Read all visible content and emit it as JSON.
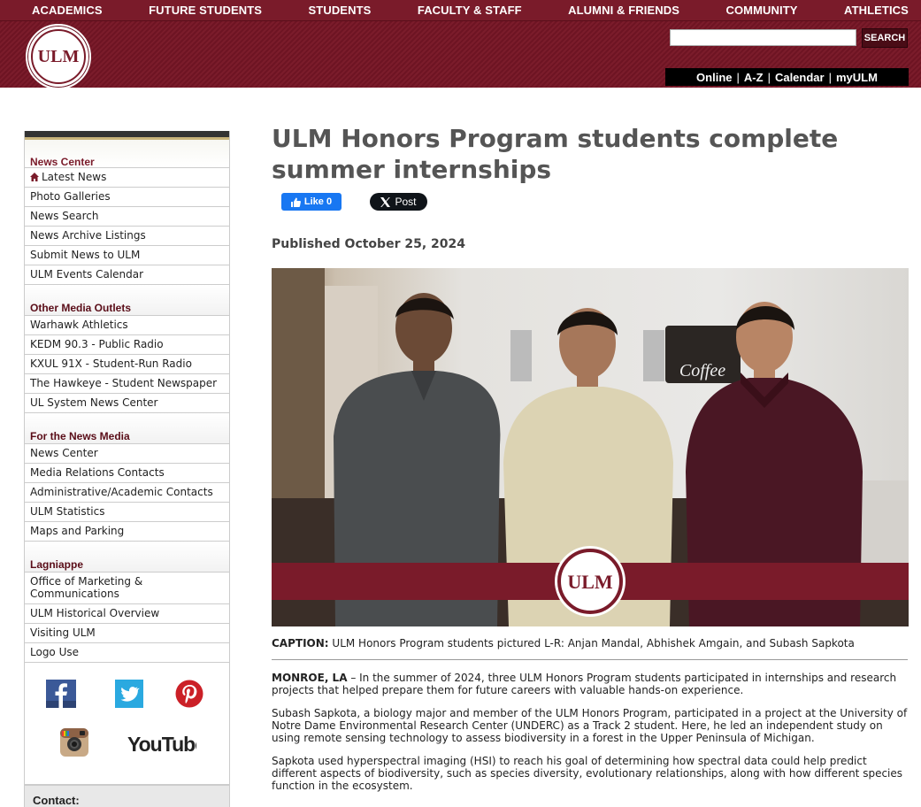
{
  "topnav": {
    "items": [
      "ACADEMICS",
      "FUTURE STUDENTS",
      "STUDENTS",
      "FACULTY & STAFF",
      "ALUMNI & FRIENDS",
      "COMMUNITY",
      "ATHLETICS"
    ]
  },
  "logo": {
    "text": "ULM"
  },
  "search": {
    "value": "",
    "button": "SEARCH"
  },
  "quicklinks": [
    "Online",
    "A-Z",
    "Calendar",
    "myULM"
  ],
  "sidebar": {
    "sections": [
      {
        "title": "News Center",
        "items": [
          "Latest News",
          "Photo Galleries",
          "News Search",
          "News Archive Listings",
          "Submit News to ULM",
          "ULM Events Calendar"
        ]
      },
      {
        "title": "Other Media Outlets",
        "items": [
          "Warhawk Athletics",
          "KEDM 90.3 - Public Radio",
          "KXUL 91X - Student-Run Radio",
          "The Hawkeye - Student Newspaper",
          "UL System News Center"
        ]
      },
      {
        "title": "For the News Media",
        "items": [
          "News Center",
          "Media Relations Contacts",
          "Administrative/Academic Contacts",
          "ULM Statistics",
          "Maps and Parking"
        ]
      },
      {
        "title": "Lagniappe",
        "items": [
          "Office of Marketing & Communications",
          "ULM Historical Overview",
          "Visiting ULM",
          "Logo Use"
        ]
      }
    ],
    "social": [
      "facebook-icon",
      "twitter-icon",
      "pinterest-icon",
      "instagram-icon",
      "youtube-icon"
    ],
    "youtube_label": "YouTube",
    "contact": "Contact:"
  },
  "article": {
    "title": "ULM Honors Program students complete summer internships",
    "like": "Like 0",
    "post": "Post",
    "published": "Published October 25, 2024",
    "caption_label": "CAPTION:",
    "caption_text": " ULM Honors Program students pictured L-R: Anjan Mandal, Abhishek Amgain, and Subash Sapkota",
    "dateline": "MONROE, LA",
    "p1": " – In the summer of 2024, three ULM Honors Program students participated in internships and research projects that helped prepare them for future careers with valuable hands-on experience.",
    "p2": "Subash Sapkota, a biology major and member of the ULM Honors Program, participated in a project at the University of Notre Dame Environmental Research Center (UNDERC) as a Track 2 student. Here, he led an independent study on using remote sensing technology to assess biodiversity in a forest in the Upper Peninsula of Michigan.",
    "p3": "Sapkota used hyperspectral imaging (HSI) to reach his goal of determining how spectral data could help predict different aspects of biodiversity, such as species diversity, evolutionary relationships, along with how different species function in the ecosystem.",
    "photo_sign": "Coffee",
    "photo_logo": "ULM"
  },
  "colors": {
    "maroon": "#7a1b2a",
    "black": "#000000",
    "link": "#222222"
  }
}
